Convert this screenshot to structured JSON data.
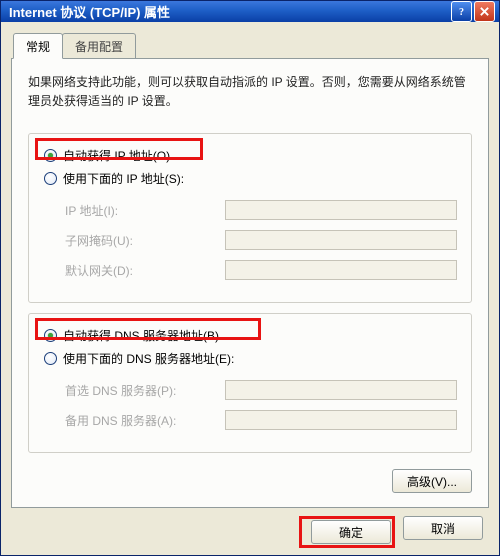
{
  "window": {
    "title": "Internet 协议 (TCP/IP) 属性"
  },
  "tabs": {
    "general": "常规",
    "alternate": "备用配置"
  },
  "description": "如果网络支持此功能，则可以获取自动指派的 IP 设置。否则，您需要从网络系统管理员处获得适当的 IP 设置。",
  "ip": {
    "auto_label": "自动获得 IP 地址(O)",
    "manual_label": "使用下面的 IP 地址(S):",
    "fields": {
      "ip_label": "IP 地址(I):",
      "mask_label": "子网掩码(U):",
      "gateway_label": "默认网关(D):"
    }
  },
  "dns": {
    "auto_label": "自动获得 DNS 服务器地址(B)",
    "manual_label": "使用下面的 DNS 服务器地址(E):",
    "fields": {
      "pref_label": "首选 DNS 服务器(P):",
      "alt_label": "备用 DNS 服务器(A):"
    }
  },
  "buttons": {
    "advanced": "高级(V)...",
    "ok": "确定",
    "cancel": "取消"
  }
}
